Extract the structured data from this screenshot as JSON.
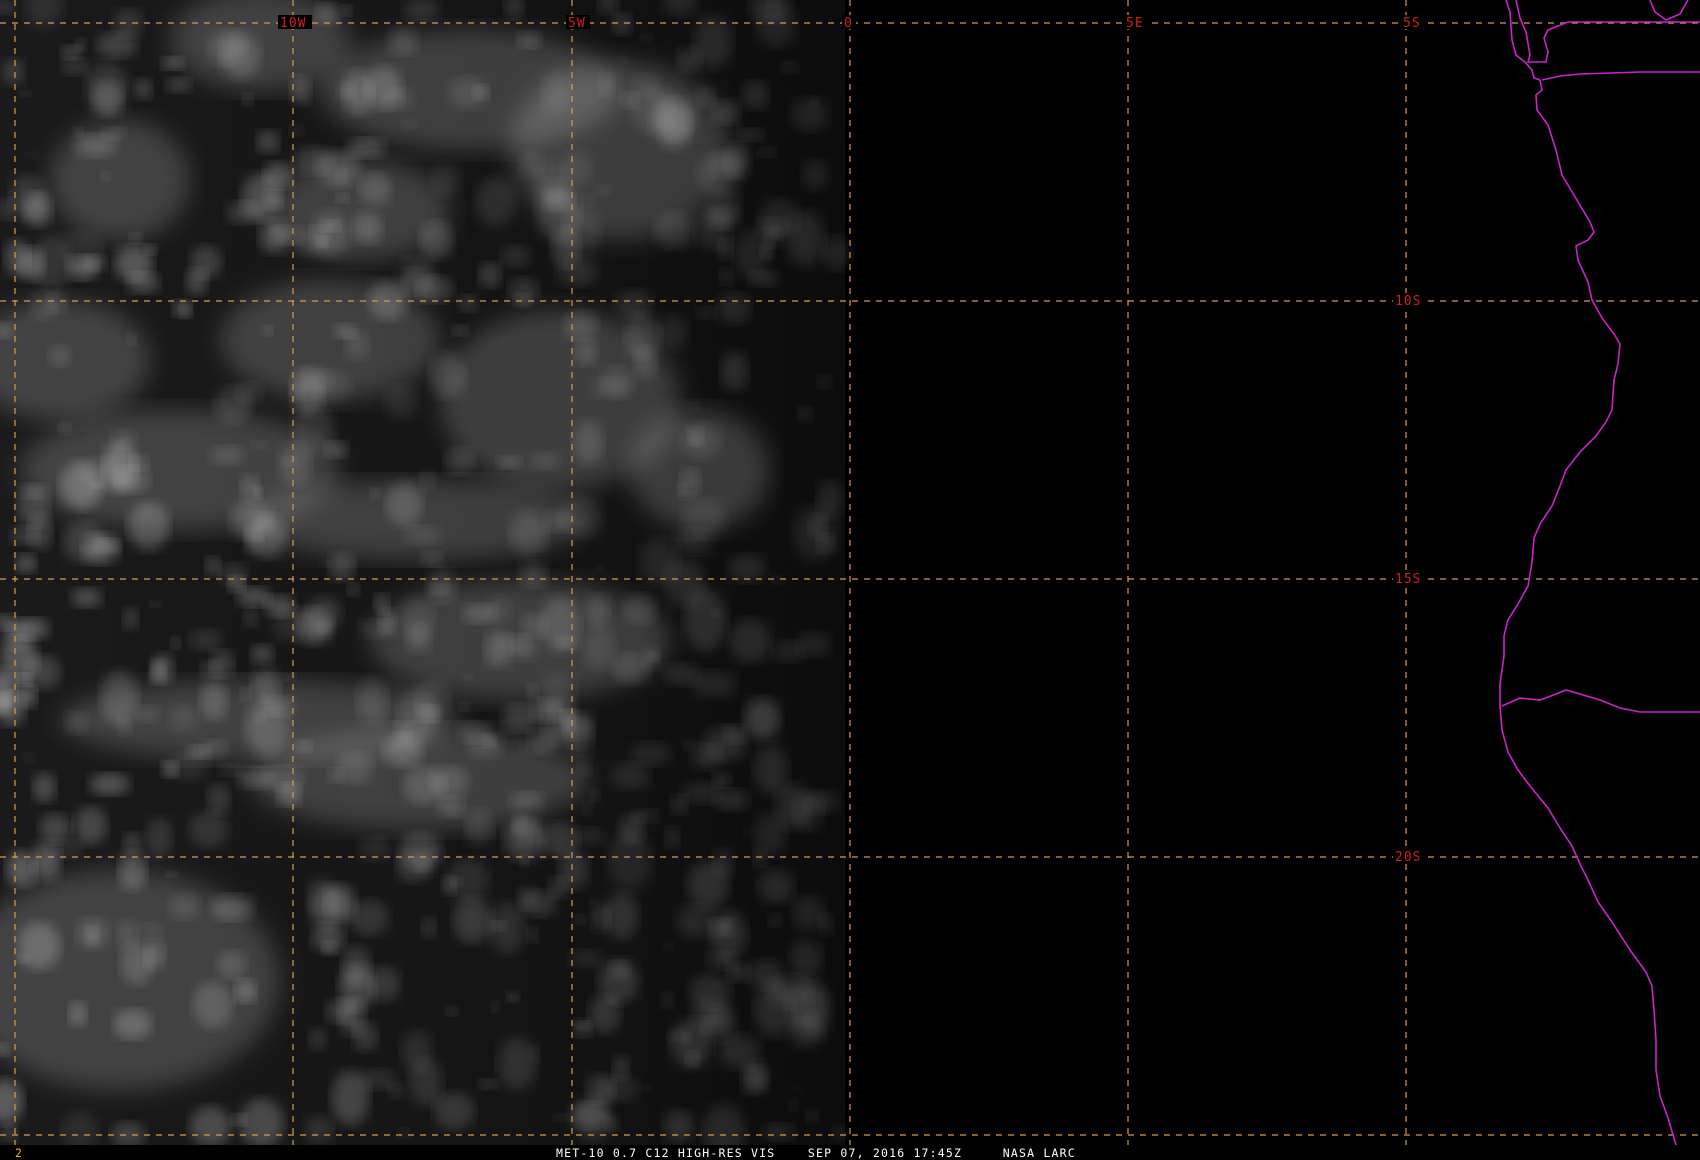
{
  "imagery": {
    "satellite": "MET-10",
    "band": "0.7",
    "channel": "C12",
    "product": "HIGH-RES VIS",
    "date": "SEP 07, 2016",
    "time": "17:45Z",
    "source": "NASA LARC"
  },
  "status_bar": {
    "frame_number": "2",
    "caption": "MET-10 0.7 C12 HIGH-RES VIS    SEP 07, 2016 17:45Z     NASA LARC"
  },
  "grid": {
    "longitude_labels": [
      "10W",
      "5W",
      "0",
      "5E"
    ],
    "latitude_labels": [
      "5S",
      "10S",
      "15S",
      "20S"
    ]
  },
  "colors": {
    "background": "#000000",
    "grid_line": "#d79a54",
    "grid_label": "#d01f1f",
    "coastline": "#cc22cc",
    "status_text": "#ffffff",
    "frame_number": "#e0c000",
    "cloud": "#ffffff"
  }
}
